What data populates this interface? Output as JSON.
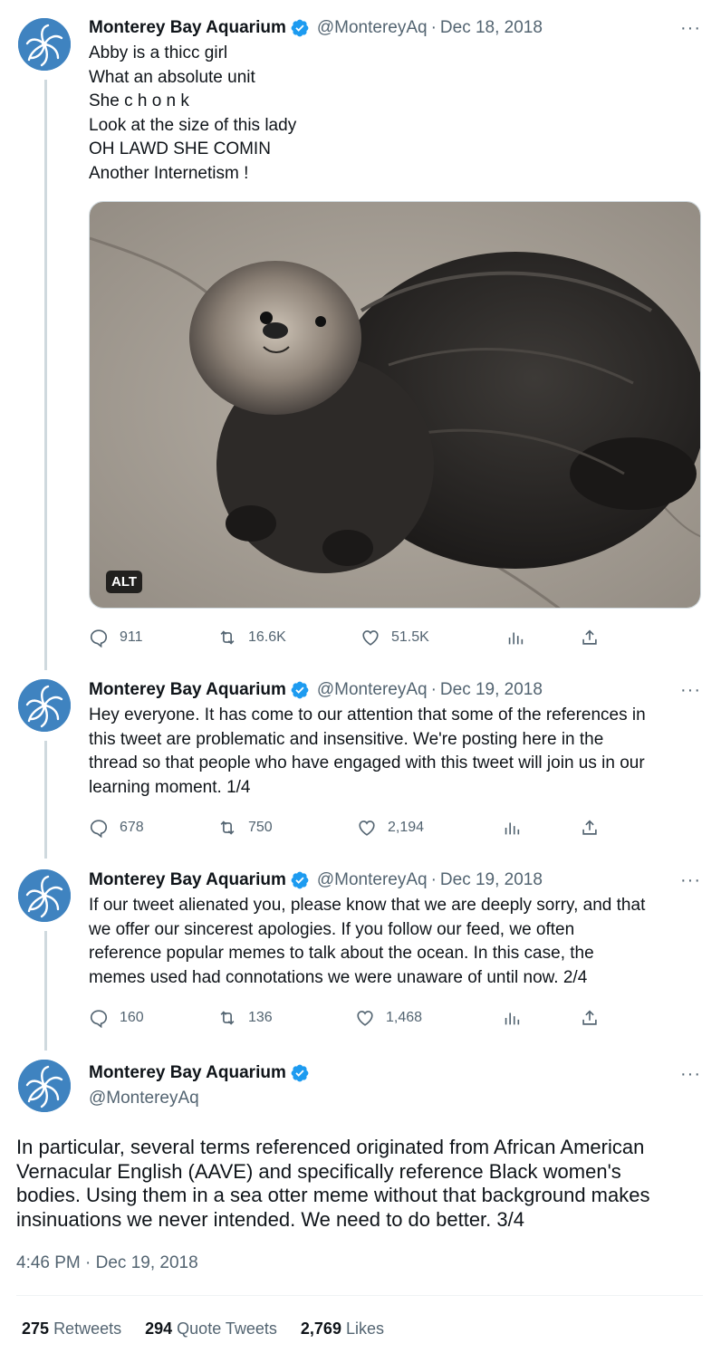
{
  "account": {
    "name": "Monterey Bay Aquarium",
    "handle": "@MontereyAq",
    "brand_color": "#3f83c0",
    "verified_color": "#1d9bf0"
  },
  "tweets": [
    {
      "date": "Dec 18, 2018",
      "lines": [
        "Abby is a thicc girl",
        "What an absolute unit",
        "She c h o n k",
        "Look at the size of this lady",
        "OH LAWD SHE COMIN",
        "Another Internetism !"
      ],
      "media_alt_badge": "ALT",
      "replies": "911",
      "retweets": "16.6K",
      "likes": "51.5K"
    },
    {
      "date": "Dec 19, 2018",
      "lines": [
        "Hey everyone. It has come to our attention that some of the references in",
        "this tweet are problematic and insensitive. We're posting here in the",
        "thread so that people who have engaged with this tweet will join us in our",
        "learning moment. 1/4"
      ],
      "replies": "678",
      "retweets": "750",
      "likes": "2,194"
    },
    {
      "date": "Dec 19, 2018",
      "lines": [
        "If our tweet alienated you, please know that we are deeply sorry, and that",
        "we offer our sincerest apologies. If you follow our feed, we often",
        "reference popular memes to talk about the ocean. In this case, the",
        "memes used had connotations we were unaware of until now. 2/4"
      ],
      "replies": "160",
      "retweets": "136",
      "likes": "1,468"
    }
  ],
  "focused": {
    "lines": [
      "In particular, several terms referenced originated from African American",
      "Vernacular English (AAVE) and specifically reference Black women's",
      "bodies. Using them in a sea otter meme without that background makes",
      "insinuations we never intended. We need to do better. 3/4"
    ],
    "timestamp": "4:46 PM · Dec 19, 2018",
    "stats": {
      "retweets_count": "275",
      "retweets_label": "Retweets",
      "quotes_count": "294",
      "quotes_label": "Quote Tweets",
      "likes_count": "2,769",
      "likes_label": "Likes"
    }
  }
}
